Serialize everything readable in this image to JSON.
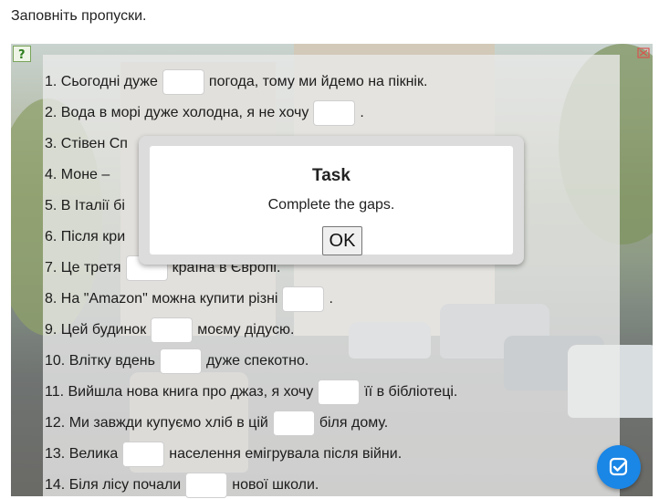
{
  "instruction": "Заповніть пропуски.",
  "sentences": [
    {
      "before": "1. Сьогодні дуже",
      "after": "погода, тому ми йдемо на пікнік."
    },
    {
      "before": "2. Вода в морі дуже холодна, я не хочу",
      "after": "."
    },
    {
      "before": "3. Стівен Сп",
      "after": ""
    },
    {
      "before": "4. Моне –",
      "after": ""
    },
    {
      "before": "5. В Італії бі",
      "after": ""
    },
    {
      "before": "6. Після кри",
      "after": ""
    },
    {
      "before": "7. Це третя",
      "after": "країна в Європі."
    },
    {
      "before": "8. На \"Amazon\" можна купити різні",
      "after": "."
    },
    {
      "before": "9. Цей будинок",
      "after": "моєму дідусю."
    },
    {
      "before": "10. Влітку вдень",
      "after": "дуже спекотно."
    },
    {
      "before": "11. Вийшла нова книга про джаз, я хочу",
      "after": "її в бібліотеці."
    },
    {
      "before": "12. Ми завжди купуємо хліб в цій",
      "after": "біля дому."
    },
    {
      "before": "13. Велика",
      "after": "населення емігрувала після війни."
    },
    {
      "before": "14. Біля лісу почали",
      "after": "нової школи."
    }
  ],
  "modal": {
    "title": "Task",
    "text": "Complete the gaps.",
    "ok_label": "OK"
  },
  "colors": {
    "check_button": "#1a86e6",
    "help_icon": "#7aa35a",
    "fullscreen_icon": "#d9534f"
  },
  "icons": {
    "help": "help-icon",
    "fullscreen": "fullscreen-icon",
    "check": "check-icon"
  }
}
